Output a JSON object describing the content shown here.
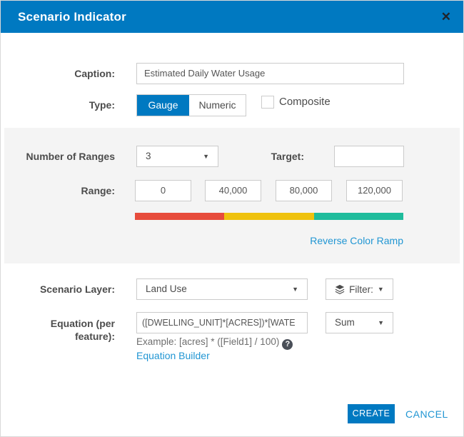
{
  "dialog": {
    "title": "Scenario Indicator"
  },
  "icons": {
    "close": "✕",
    "dropdown_arrow": "▼",
    "help": "?"
  },
  "colors": {
    "primary": "#0079c1",
    "link": "#2196d3",
    "ramp": [
      "#e74c3c",
      "#efc20e",
      "#1fbc9c"
    ]
  },
  "caption": {
    "label": "Caption:",
    "value": "Estimated Daily Water Usage"
  },
  "type": {
    "label": "Type:",
    "selected_option": "Gauge",
    "other_option": "Numeric",
    "composite_label": "Composite",
    "composite_checked": false
  },
  "ranges": {
    "number_label": "Number of Ranges",
    "number_value": "3",
    "target_label": "Target:",
    "target_value": "",
    "range_label": "Range:",
    "range_values": [
      "0",
      "40,000",
      "80,000",
      "120,000"
    ],
    "reverse_link": "Reverse Color Ramp"
  },
  "scenario_layer": {
    "label": "Scenario Layer:",
    "value": "Land Use",
    "filter_label": "Filter:"
  },
  "equation": {
    "label_line1": "Equation (per",
    "label_line2": "feature):",
    "value": "([DWELLING_UNIT]*[ACRES])*[WATE",
    "aggregation": "Sum",
    "example": "Example: [acres] * ([Field1] / 100)",
    "builder_link": "Equation Builder"
  },
  "footer": {
    "create": "CREATE",
    "cancel": "CANCEL"
  }
}
